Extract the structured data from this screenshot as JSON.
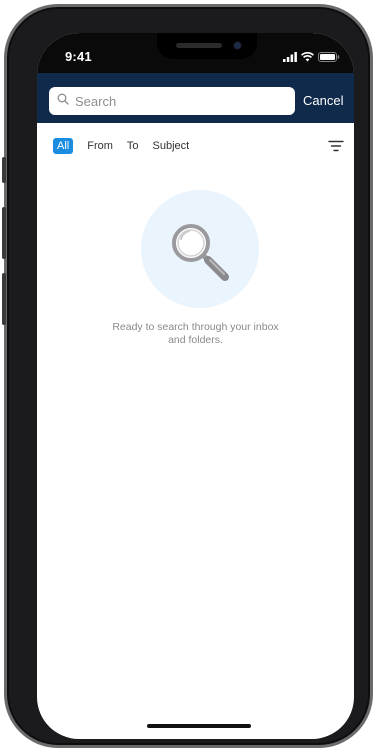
{
  "status_bar": {
    "time": "9:41"
  },
  "search": {
    "placeholder": "Search",
    "value": "",
    "cancel_label": "Cancel"
  },
  "filters": {
    "items": [
      {
        "label": "All",
        "active": true
      },
      {
        "label": "From",
        "active": false
      },
      {
        "label": "To",
        "active": false
      },
      {
        "label": "Subject",
        "active": false
      }
    ],
    "filter_icon": "filter-lines-icon"
  },
  "empty_state": {
    "icon": "magnifying-glass-icon",
    "line1": "Ready to search through your inbox",
    "line2": "and folders."
  },
  "colors": {
    "header_bg": "#0f2a4a",
    "accent": "#1a8de0",
    "empty_circle": "#eaf4fd",
    "muted_text": "#8a8a8e"
  }
}
